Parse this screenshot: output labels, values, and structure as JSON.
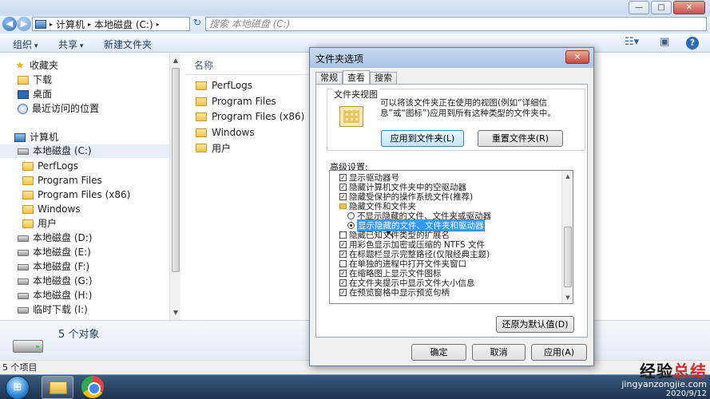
{
  "explorer": {
    "title_buttons": {
      "minimize": "—",
      "maximize": "□",
      "close": "✕"
    },
    "address": {
      "crumbs": [
        "计算机",
        "本地磁盘 (C:)"
      ],
      "separator": "▸"
    },
    "search_placeholder": "搜索 本地磁盘 (C:)",
    "toolbar": {
      "organize": "组织",
      "share": "共享",
      "new_folder": "新建文件夹",
      "help": "?"
    },
    "nav": {
      "favorites": "收藏夹",
      "favorites_items": [
        "下载",
        "桌面",
        "最近访问的位置"
      ],
      "computer": "计算机",
      "selected_drive": "本地磁盘 (C:)",
      "c_folders": [
        "PerfLogs",
        "Program Files",
        "Program Files (x86)",
        "Windows",
        "用户"
      ],
      "drives": [
        "本地磁盘 (D:)",
        "本地磁盘 (E:)",
        "本地磁盘 (F:)",
        "本地磁盘 (G:)",
        "本地磁盘 (H:)",
        "临时下载 (I:)"
      ]
    },
    "content": {
      "column_name": "名称",
      "files": [
        "PerfLogs",
        "Program Files",
        "Program Files (x86)",
        "Windows",
        "用户"
      ]
    },
    "details_count": "5 个对象",
    "status": "5 个项目"
  },
  "dialog": {
    "title": "文件夹选项",
    "close": "✕",
    "tabs": [
      "常规",
      "查看",
      "搜索"
    ],
    "active_tab": "查看",
    "folder_views_legend": "文件夹视图",
    "folder_views_text": "可以将该文件夹正在使用的视图(例如“详细信息”或“图标”)应用到所有这种类型的文件夹中。",
    "apply_to_folders": "应用到文件夹(L)",
    "reset_folders": "重置文件夹(R)",
    "advanced_label": "高级设置:",
    "advanced_items": [
      {
        "kind": "checkbox",
        "checked": true,
        "label": "显示驱动器号"
      },
      {
        "kind": "checkbox",
        "checked": true,
        "label": "隐藏计算机文件夹中的空驱动器"
      },
      {
        "kind": "checkbox",
        "checked": true,
        "label": "隐藏受保护的操作系统文件(推荐)"
      },
      {
        "kind": "folder",
        "label": "隐藏文件和文件夹"
      },
      {
        "kind": "radio",
        "checked": false,
        "label": "不显示隐藏的文件、文件夹或驱动器"
      },
      {
        "kind": "radio",
        "checked": true,
        "label": "显示隐藏的文件、文件夹和驱动器"
      },
      {
        "kind": "checkbox",
        "checked": false,
        "label": "隐藏已知文件类型的扩展名"
      },
      {
        "kind": "checkbox",
        "checked": true,
        "label": "用彩色显示加密或压缩的 NTFS 文件"
      },
      {
        "kind": "checkbox",
        "checked": true,
        "label": "在标题栏显示完整路径(仅限经典主题)"
      },
      {
        "kind": "checkbox",
        "checked": false,
        "label": "在单独的进程中打开文件夹窗口"
      },
      {
        "kind": "checkbox",
        "checked": true,
        "label": "在缩略图上显示文件图标"
      },
      {
        "kind": "checkbox",
        "checked": true,
        "label": "在文件夹提示中显示文件大小信息"
      },
      {
        "kind": "checkbox",
        "checked": true,
        "label": "在预览窗格中显示预览句柄"
      }
    ],
    "restore_defaults": "还原为默认值(D)",
    "ok": "确定",
    "cancel": "取消",
    "apply": "应用(A)"
  },
  "watermark": {
    "title_black": "经验",
    "title_red": "总结",
    "url": "jingyanzongjie.com",
    "date": "2020/9/12"
  },
  "icons": [
    "back-icon",
    "forward-icon",
    "folder-icon",
    "drive-icon",
    "star-icon",
    "help-icon",
    "start-orb-icon",
    "chrome-icon"
  ]
}
